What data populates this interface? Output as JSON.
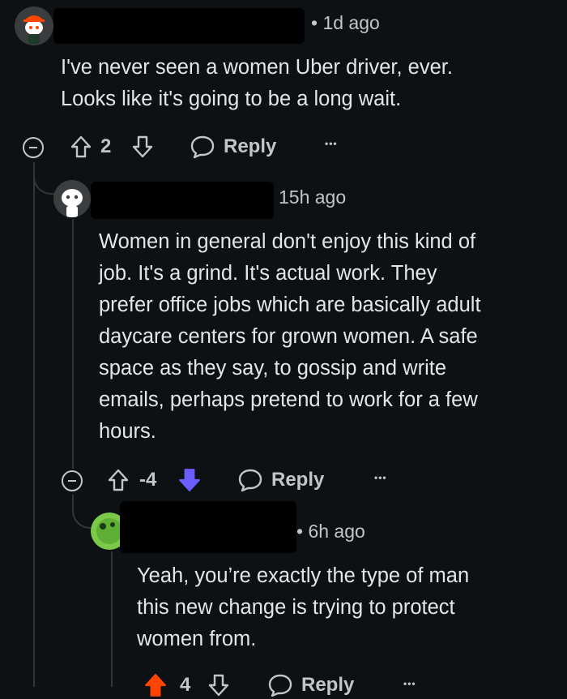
{
  "comments": [
    {
      "time": "• 1d ago",
      "body": [
        "I've never seen a women Uber driver, ever.",
        "Looks like it's going to be a long wait."
      ],
      "score": "2",
      "reply_label": "Reply",
      "more_label": "•••"
    },
    {
      "time": "15h ago",
      "body": [
        "Women in general don't enjoy this kind of",
        "job. It's a grind. It's actual work. They",
        "prefer office jobs which are basically adult",
        "daycare centers for grown women. A safe",
        "space as they say, to gossip and write",
        "emails, perhaps pretend to work for a few",
        "hours."
      ],
      "score": "-4",
      "reply_label": "Reply",
      "more_label": "•••",
      "downvoted_color": "#6a5cff"
    },
    {
      "time": "• 6h ago",
      "body": [
        "Yeah, you’re exactly the type of man",
        "this new change is trying to protect",
        "women from."
      ],
      "score": "4",
      "reply_label": "Reply",
      "more_label": "•••",
      "upvoted_color": "#ff4500"
    }
  ]
}
